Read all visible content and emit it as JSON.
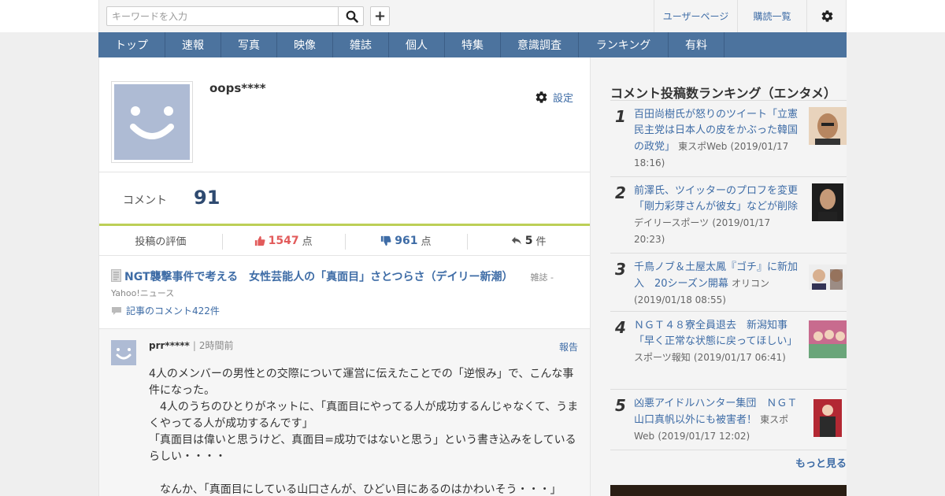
{
  "header": {
    "search_placeholder": "キーワードを入力",
    "plus_label": "+",
    "user_page": "ユーザーページ",
    "subscriptions": "購読一覧"
  },
  "nav": [
    "トップ",
    "速報",
    "写真",
    "映像",
    "雑誌",
    "個人",
    "特集",
    "意識調査",
    "ランキング",
    "有料"
  ],
  "profile": {
    "username": "oops****",
    "settings": "設定",
    "comment_label": "コメント",
    "comment_count": "91",
    "rating_label": "投稿の評価",
    "likes": "1547",
    "likes_unit": "点",
    "dislikes": "961",
    "dislikes_unit": "点",
    "replies": "5",
    "replies_unit": "件"
  },
  "article": {
    "title": "NGT襲撃事件で考える　女性芸能人の「真面目」さとつらさ（デイリー新潮）",
    "category": "雑誌 -",
    "source": "Yahoo!ニュース",
    "comments_link": "記事のコメント422件"
  },
  "comment": {
    "user": "prr*****",
    "separator": "|",
    "time": "2時間前",
    "report": "報告",
    "lines": [
      "4人のメンバーの男性との交際について運営に伝えたことでの「逆恨み」で、こんな事件になった。",
      "　4人のうちのひとりがネットに、「真面目にやってる人が成功するんじゃなくて、うまくやってる人が成功するんです」",
      "「真面目は偉いと思うけど、真面目=成功ではないと思う」という書き込みをしているらしい・・・・",
      "",
      "　なんか、「真面目にしている山口さんが、ひどい目にあるのはかわいそう・・・」"
    ]
  },
  "sidebar": {
    "title": "コメント投稿数ランキング（エンタメ）",
    "items": [
      {
        "rank": "1",
        "title": "百田尚樹氏が怒りのツイート「立憲民主党は日本人の皮をかぶった韓国の政党」",
        "source": "東スポWeb",
        "date": "(2019/01/17 18:16)"
      },
      {
        "rank": "2",
        "title": "前澤氏、ツイッターのプロフを変更「剛力彩芽さんが彼女」などが削除",
        "source": "デイリースポーツ",
        "date": "(2019/01/17 20:23)"
      },
      {
        "rank": "3",
        "title": "千鳥ノブ＆土屋太鳳『ゴチ』に新加入　20シーズン開幕",
        "source": "オリコン",
        "date": "(2019/01/18 08:55)"
      },
      {
        "rank": "4",
        "title": "ＮＧＴ４８寮全員退去　新潟知事「早く正常な状態に戻ってほしい」",
        "source": "スポーツ報知",
        "date": "(2019/01/17 06:41)"
      },
      {
        "rank": "5",
        "title": "凶悪アイドルハンター集団　ＮＧＴ山口真帆以外にも被害者！",
        "source": "東スポWeb",
        "date": "(2019/01/17 12:02)"
      }
    ],
    "more": "もっと見る"
  }
}
